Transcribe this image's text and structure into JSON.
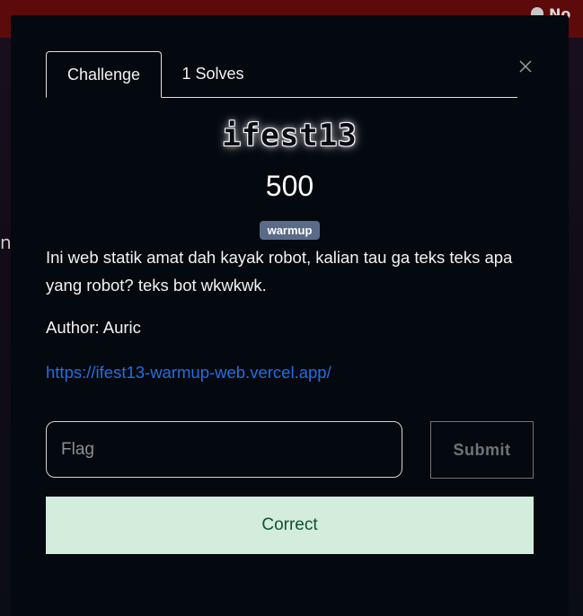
{
  "topbar": {
    "user_label": "No"
  },
  "left_peek": {
    "glyph": "n"
  },
  "modal": {
    "tabs": [
      {
        "label": "Challenge",
        "active": true
      },
      {
        "label": "1 Solves",
        "active": false
      }
    ],
    "close_icon": "close-icon",
    "challenge": {
      "name": "ifest13",
      "points": "500",
      "tag": "warmup",
      "description": "Ini web statik amat dah kayak robot, kalian tau ga teks teks apa yang robot? teks bot wkwkwk.",
      "author": "Author: Auric",
      "link": "https://ifest13-warmup-web.vercel.app/"
    },
    "flag_input": {
      "placeholder": "Flag",
      "value": ""
    },
    "submit_label": "Submit",
    "result_text": "Correct"
  },
  "colors": {
    "topbar": "#5c0a0a",
    "modal_bg": "#04080f",
    "tag_bg": "#5a6b8a",
    "link": "#1f6fe5",
    "success_bg": "#d4ecdb",
    "success_text": "#0f5132"
  }
}
